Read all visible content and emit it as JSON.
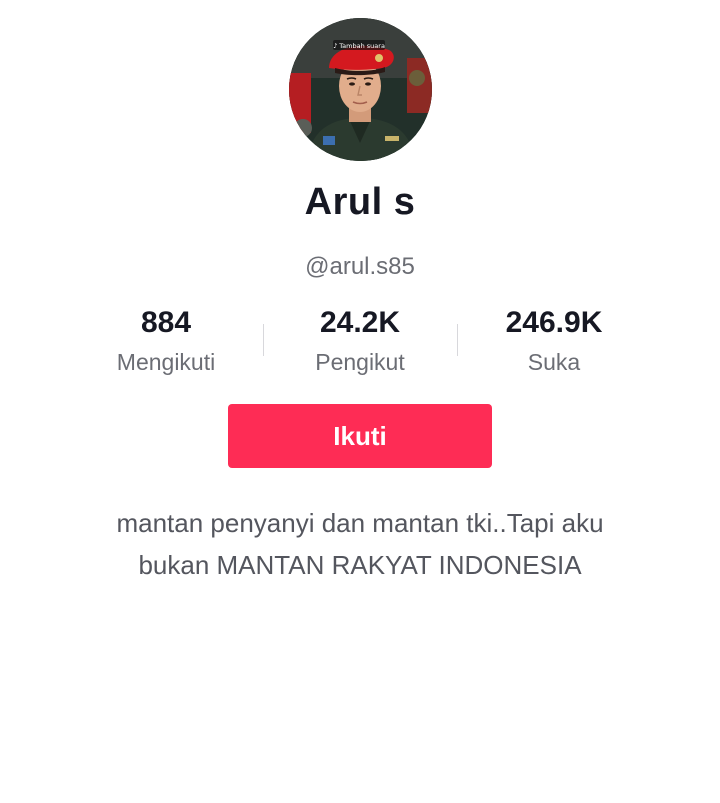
{
  "profile": {
    "avatar_icon": "profile-photo",
    "avatar_overlay_text": "♪ Tambah suara",
    "display_name": "Arul s",
    "username": "@arul.s85"
  },
  "stats": {
    "following": {
      "value": "884",
      "label": "Mengikuti"
    },
    "followers": {
      "value": "24.2K",
      "label": "Pengikut"
    },
    "likes": {
      "value": "246.9K",
      "label": "Suka"
    }
  },
  "follow_button": {
    "label": "Ikuti",
    "color": "#fe2c55"
  },
  "bio": {
    "line1": "mantan penyanyi dan mantan tki..Tapi aku",
    "line2": "bukan MANTAN RAKYAT INDONESIA"
  }
}
